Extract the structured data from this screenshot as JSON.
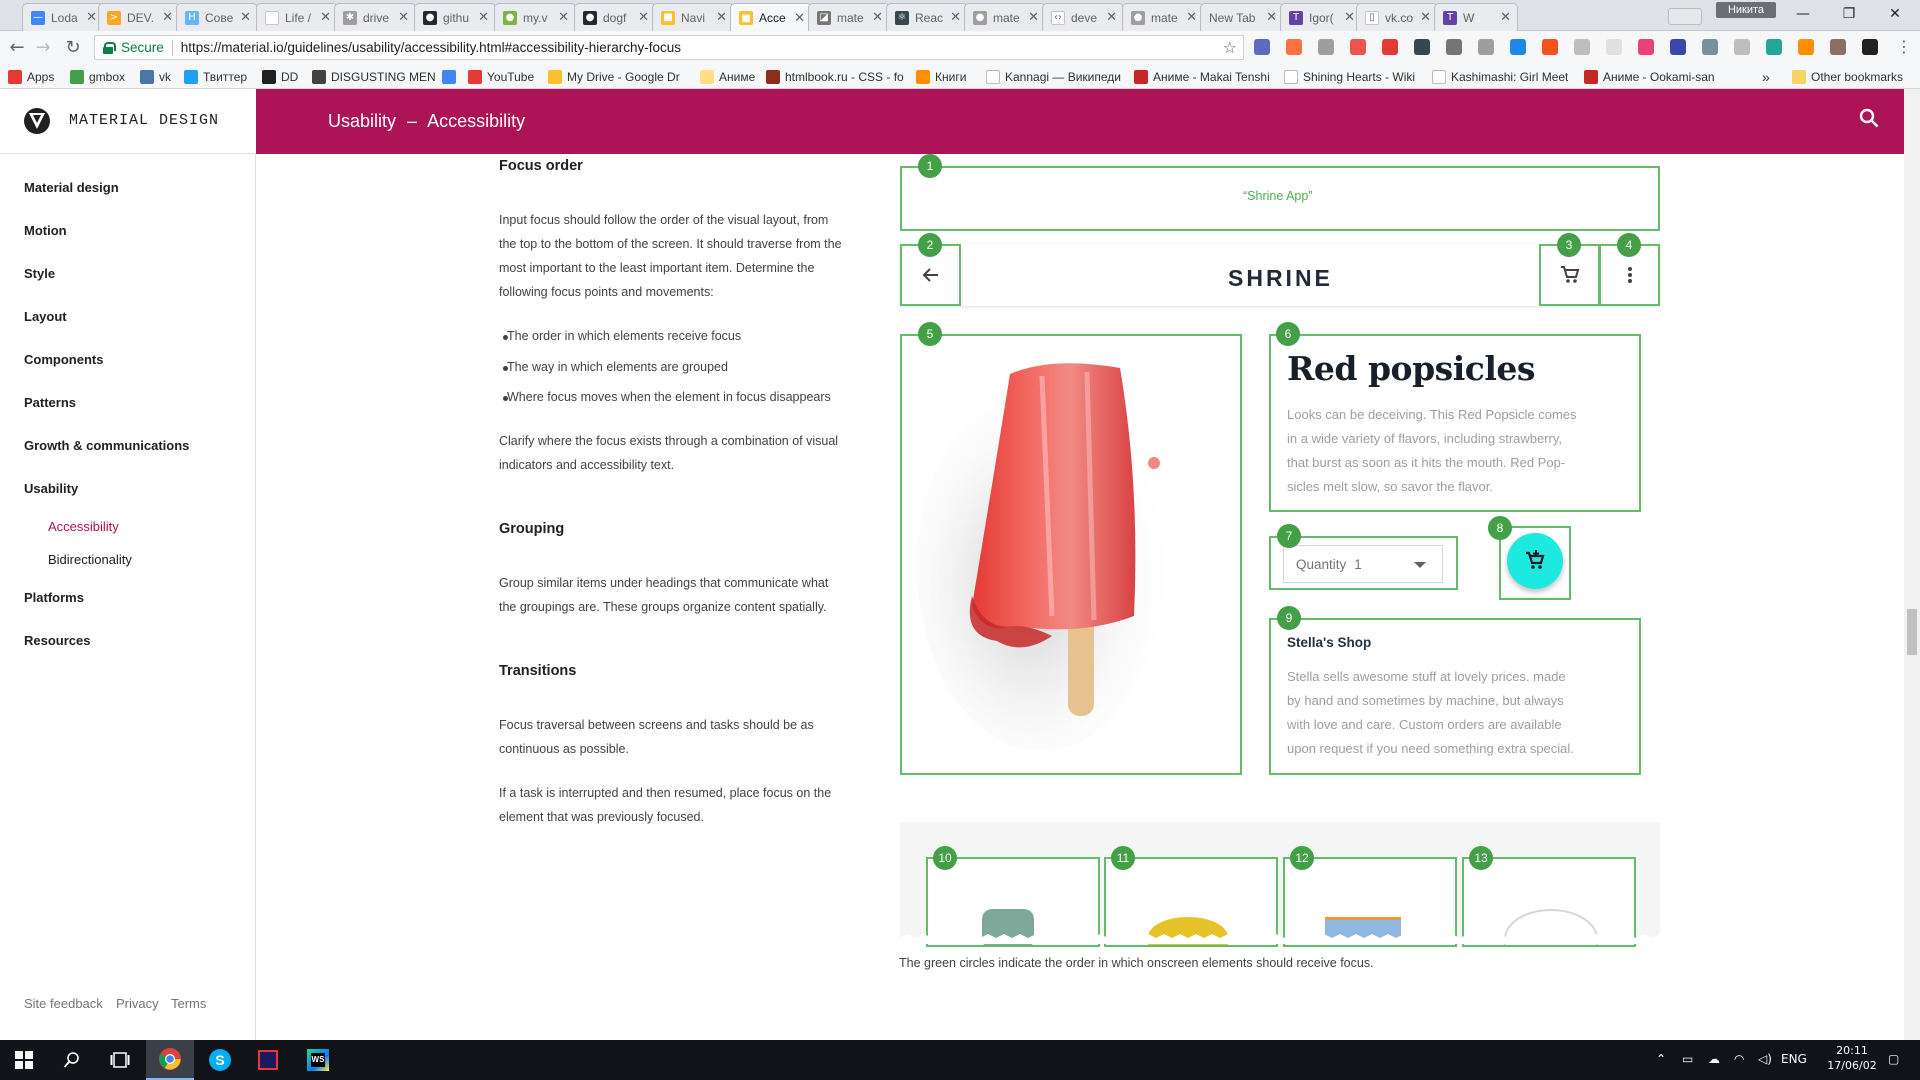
{
  "browser": {
    "tabs": [
      {
        "label": "Loda",
        "fav_color": "#4285f4",
        "fav_glyph": "—"
      },
      {
        "label": "DEV.",
        "fav_color": "#f9a825",
        "fav_glyph": ">"
      },
      {
        "label": "Сове",
        "fav_color": "#64b5f6",
        "fav_glyph": "H"
      },
      {
        "label": "Life /",
        "fav_color": "#ffffff",
        "fav_glyph": ""
      },
      {
        "label": "drive",
        "fav_color": "#9e9e9e",
        "fav_glyph": "✱"
      },
      {
        "label": "githu",
        "fav_color": "#24292e",
        "fav_glyph": "●"
      },
      {
        "label": "my.v",
        "fav_color": "#7cb342",
        "fav_glyph": "●"
      },
      {
        "label": "dogf",
        "fav_color": "#24292e",
        "fav_glyph": "●"
      },
      {
        "label": "Navi",
        "fav_color": "#fbc02d",
        "fav_glyph": "■"
      },
      {
        "label": "Acce",
        "fav_color": "#fbc02d",
        "fav_glyph": "■"
      },
      {
        "label": "mate",
        "fav_color": "#757575",
        "fav_glyph": "◪"
      },
      {
        "label": "Reac",
        "fav_color": "#37474f",
        "fav_glyph": "⚛"
      },
      {
        "label": "mate",
        "fav_color": "#9e9e9e",
        "fav_glyph": "●"
      },
      {
        "label": "deve",
        "fav_color": "#ffffff",
        "fav_glyph": "‹›"
      },
      {
        "label": "mate",
        "fav_color": "#9e9e9e",
        "fav_glyph": "●"
      },
      {
        "label": "New Tab",
        "fav_color": "",
        "fav_glyph": ""
      },
      {
        "label": "Igor(",
        "fav_color": "#6441a5",
        "fav_glyph": "T"
      },
      {
        "label": "vk.co",
        "fav_color": "#ffffff",
        "fav_glyph": "▯"
      },
      {
        "label": "W",
        "fav_color": "#6441a5",
        "fav_glyph": "T"
      }
    ],
    "active_tab": 9,
    "profile_name": "Никита",
    "secure_label": "Secure",
    "url": "https://material.io/guidelines/usability/accessibility.html#accessibility-hierarchy-focus",
    "bookmarks": [
      {
        "label": "Apps",
        "color": "#e53935"
      },
      {
        "label": "gmbox",
        "color": "#43a047"
      },
      {
        "label": "vk",
        "color": "#4a76a8"
      },
      {
        "label": "Твиттер",
        "color": "#1da1f2"
      },
      {
        "label": "DD",
        "color": "#212121"
      },
      {
        "label": "DISGUSTING MEN",
        "color": "#424242"
      },
      {
        "label": "",
        "color": "#4285f4"
      },
      {
        "label": "YouTube",
        "color": "#e53935"
      },
      {
        "label": "My Drive - Google Dr",
        "color": "#fbc02d"
      },
      {
        "label": "Аниме",
        "color": "#ffe082"
      },
      {
        "label": "htmlbook.ru - CSS - fo",
        "color": "#8d2e1c"
      },
      {
        "label": "Книги",
        "color": "#ff8f00"
      },
      {
        "label": "Kannagi — Википеди",
        "color": "#ffffff"
      },
      {
        "label": "Аниме - Makai Tenshi",
        "color": "#c62828"
      },
      {
        "label": "Shining Hearts - Wiki",
        "color": "#ffffff"
      },
      {
        "label": "Kashimashi: Girl Meet",
        "color": "#ffffff"
      },
      {
        "label": "Аниме - Ookami-san",
        "color": "#c62828"
      }
    ],
    "bookmarks_more": "»",
    "other_bookmarks": "Other bookmarks"
  },
  "header": {
    "brand": "MATERIAL DESIGN",
    "section": "Usability",
    "separator": "–",
    "page": "Accessibility",
    "bg_color": "#ad1457"
  },
  "sidebar": {
    "items": [
      {
        "label": "Material design"
      },
      {
        "label": "Motion"
      },
      {
        "label": "Style"
      },
      {
        "label": "Layout"
      },
      {
        "label": "Components"
      },
      {
        "label": "Patterns"
      },
      {
        "label": "Growth & communications"
      },
      {
        "label": "Usability"
      },
      {
        "label": "Platforms"
      },
      {
        "label": "Resources"
      }
    ],
    "sub_items": [
      {
        "label": "Accessibility",
        "active": true
      },
      {
        "label": "Bidirectionality",
        "active": false
      }
    ],
    "footer": [
      "Site feedback",
      "Privacy",
      "Terms"
    ]
  },
  "content": {
    "focus_order": {
      "heading": "Focus order",
      "lines": [
        "Input focus should follow the order of the visual layout, from",
        "the top to the bottom of the screen. It should traverse from the",
        "most important to the least important item. Determine the",
        "following focus points and movements:"
      ],
      "bullets": [
        "The order in which elements receive focus",
        "The way in which elements are grouped",
        "Where focus moves when the element in focus disappears"
      ],
      "clarify_lines": [
        "Clarify where the focus exists through a combination of visual",
        "indicators and accessibility text."
      ]
    },
    "grouping": {
      "heading": "Grouping",
      "lines": [
        "Group similar items under headings that communicate what",
        "the groupings are. These groups organize content spatially."
      ]
    },
    "transitions": {
      "heading": "Transitions",
      "lines1": [
        "Focus traversal between screens and tasks should be as",
        "continuous as possible."
      ],
      "lines2": [
        "If a task is interrupted and then resumed, place focus on the",
        "element that was previously focused."
      ]
    }
  },
  "figure": {
    "app_label": "“Shrine App”",
    "shrine_logo": "SHRINE",
    "numbers": [
      "1",
      "2",
      "3",
      "4",
      "5",
      "6",
      "7",
      "8",
      "9",
      "10",
      "11",
      "12",
      "13"
    ],
    "product_title": "Red popsicles",
    "product_desc_lines": [
      "Looks can be deceiving. This Red Popsicle comes",
      "in a wide variety of flavors, including strawberry,",
      "that burst as soon as it hits the mouth. Red Pop-",
      "sicles melt slow, so savor the flavor."
    ],
    "quantity_label": "Quantity",
    "quantity_value": "1",
    "shop_title": "Stella's Shop",
    "shop_desc_lines": [
      "Stella sells awesome stuff at lovely prices. made",
      "by hand and sometimes by machine, but always",
      "with love and care. Custom orders are available",
      "upon request if you need something extra special."
    ],
    "caption": "The green circles indicate the order in which onscreen elements should receive focus.",
    "accent_green": "#43a047",
    "fab_color": "#1de9e0"
  },
  "taskbar": {
    "lang": "ENG",
    "time": "20:11",
    "date": "17/06/02"
  }
}
